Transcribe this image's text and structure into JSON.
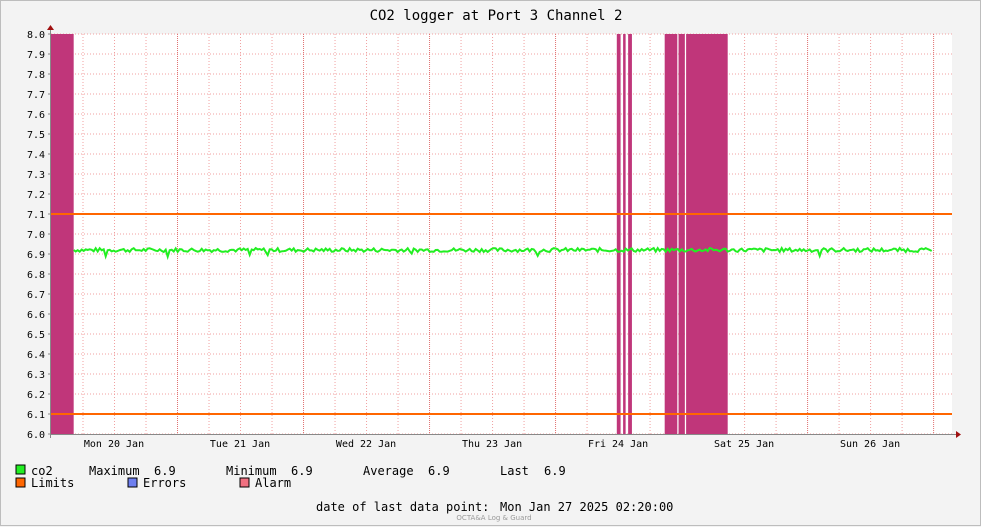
{
  "chart_data": {
    "type": "line",
    "title": "CO2 logger at Port 3 Channel 2",
    "xlabel": "",
    "ylabel": "",
    "ylim": [
      6.0,
      8.0
    ],
    "y_ticks": [
      "6.0",
      "6.1",
      "6.2",
      "6.3",
      "6.4",
      "6.5",
      "6.6",
      "6.7",
      "6.8",
      "6.9",
      "7.0",
      "7.1",
      "7.2",
      "7.3",
      "7.4",
      "7.5",
      "7.6",
      "7.7",
      "7.8",
      "7.9",
      "8.0"
    ],
    "x_range_days": [
      0,
      7.15
    ],
    "x_ticks": [
      {
        "label": "Mon 20 Jan",
        "day": 0.5
      },
      {
        "label": "Tue 21 Jan",
        "day": 1.5
      },
      {
        "label": "Wed 22 Jan",
        "day": 2.5
      },
      {
        "label": "Thu 23 Jan",
        "day": 3.5
      },
      {
        "label": "Fri 24 Jan",
        "day": 4.5
      },
      {
        "label": "Sat 25 Jan",
        "day": 5.5
      },
      {
        "label": "Sun 26 Jan",
        "day": 6.5
      }
    ],
    "grid": true,
    "series": [
      {
        "name": "co2",
        "color": "#22ee22",
        "level": 6.92,
        "start_day": 0.18,
        "end_day": 7.0
      }
    ],
    "limits": {
      "name": "Limits",
      "color": "#ff6600",
      "values": [
        6.1,
        7.1
      ]
    },
    "alarm_bands": [
      {
        "start_day": 0.0,
        "end_day": 0.18
      },
      {
        "start_day": 4.49,
        "end_day": 4.52
      },
      {
        "start_day": 4.54,
        "end_day": 4.56
      },
      {
        "start_day": 4.58,
        "end_day": 4.61
      },
      {
        "start_day": 4.87,
        "end_day": 4.97
      },
      {
        "start_day": 4.98,
        "end_day": 5.03
      },
      {
        "start_day": 5.04,
        "end_day": 5.37
      }
    ],
    "alarm_color": "#c0367a",
    "legend_placement": "bottom-left"
  },
  "legend": {
    "co2": {
      "label": "co2",
      "color": "#22ee22"
    },
    "stats": [
      {
        "label": "Maximum",
        "value": "6.9"
      },
      {
        "label": "Minimum",
        "value": "6.9"
      },
      {
        "label": "Average",
        "value": "6.9"
      },
      {
        "label": "Last",
        "value": "6.9"
      }
    ],
    "limits": {
      "label": "Limits",
      "color": "#ff6600"
    },
    "errors": {
      "label": "Errors",
      "color": "#6e7ff0"
    },
    "alarm": {
      "label": "Alarm",
      "color": "#f07080"
    }
  },
  "footer": {
    "last_point_label": "date of last data point:",
    "last_point_value": "Mon Jan 27 2025 02:20:00",
    "credit": "OCTA&A Log & Guard"
  },
  "colors": {
    "grid": "#f0a0a0",
    "axis": "#888888",
    "background": "#ffffff"
  }
}
